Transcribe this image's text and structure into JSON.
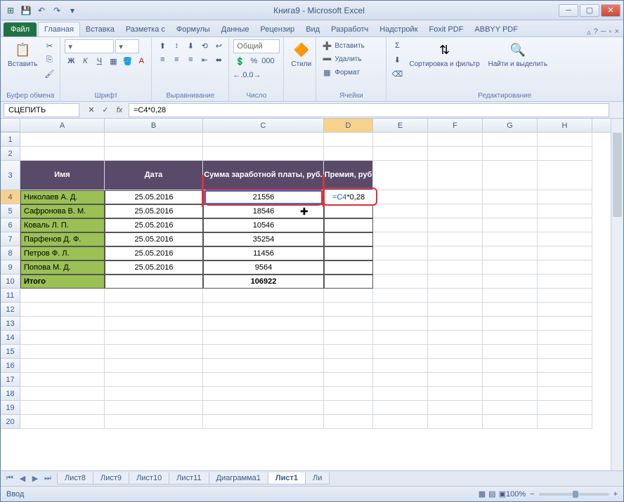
{
  "window": {
    "title": "Книга9 - Microsoft Excel"
  },
  "qat_icons": [
    "excel",
    "save",
    "undo",
    "redo"
  ],
  "file_tab": "Файл",
  "tabs": [
    "Главная",
    "Вставка",
    "Разметка с",
    "Формулы",
    "Данные",
    "Рецензир",
    "Вид",
    "Разработч",
    "Надстройк",
    "Foxit PDF",
    "ABBYY PDF"
  ],
  "active_tab": 0,
  "ribbon": {
    "clipboard": {
      "paste": "Вставить",
      "label": "Буфер обмена"
    },
    "font": {
      "label": "Шрифт",
      "bold": "Ж",
      "italic": "К",
      "underline": "Ч"
    },
    "align": {
      "label": "Выравнивание"
    },
    "number": {
      "format": "Общий",
      "label": "Число"
    },
    "styles": {
      "btn": "Стили",
      "label": ""
    },
    "cells": {
      "insert": "Вставить",
      "delete": "Удалить",
      "format": "Формат",
      "label": "Ячейки"
    },
    "editing": {
      "sort": "Сортировка и фильтр",
      "find": "Найти и выделить",
      "label": "Редактирование"
    }
  },
  "namebox": "СЦЕПИТЬ",
  "formula": "=C4*0,28",
  "columns": [
    "A",
    "B",
    "C",
    "D",
    "E",
    "F",
    "G",
    "H"
  ],
  "active_col": "D",
  "active_row": 4,
  "headers": {
    "name": "Имя",
    "date": "Дата",
    "salary": "Сумма заработной платы, руб.",
    "bonus": "Премия, руб"
  },
  "rows": [
    {
      "name": "Николаев А. Д.",
      "date": "25.05.2016",
      "salary": "21556",
      "bonus": "=C4*0,28"
    },
    {
      "name": "Сафронова В. М.",
      "date": "25.05.2016",
      "salary": "18546",
      "bonus": ""
    },
    {
      "name": "Коваль Л. П.",
      "date": "25.05.2016",
      "salary": "10546",
      "bonus": ""
    },
    {
      "name": "Парфенов Д. Ф.",
      "date": "25.05.2016",
      "salary": "35254",
      "bonus": ""
    },
    {
      "name": "Петров Ф. Л.",
      "date": "25.05.2016",
      "salary": "11456",
      "bonus": ""
    },
    {
      "name": "Попова М. Д.",
      "date": "25.05.2016",
      "salary": "9564",
      "bonus": ""
    }
  ],
  "total": {
    "label": "Итого",
    "salary": "106922"
  },
  "sheets": [
    "Лист8",
    "Лист9",
    "Лист10",
    "Лист11",
    "Диаграмма1",
    "Лист1",
    "Ли"
  ],
  "active_sheet": 5,
  "status": "Ввод",
  "zoom": "100%"
}
